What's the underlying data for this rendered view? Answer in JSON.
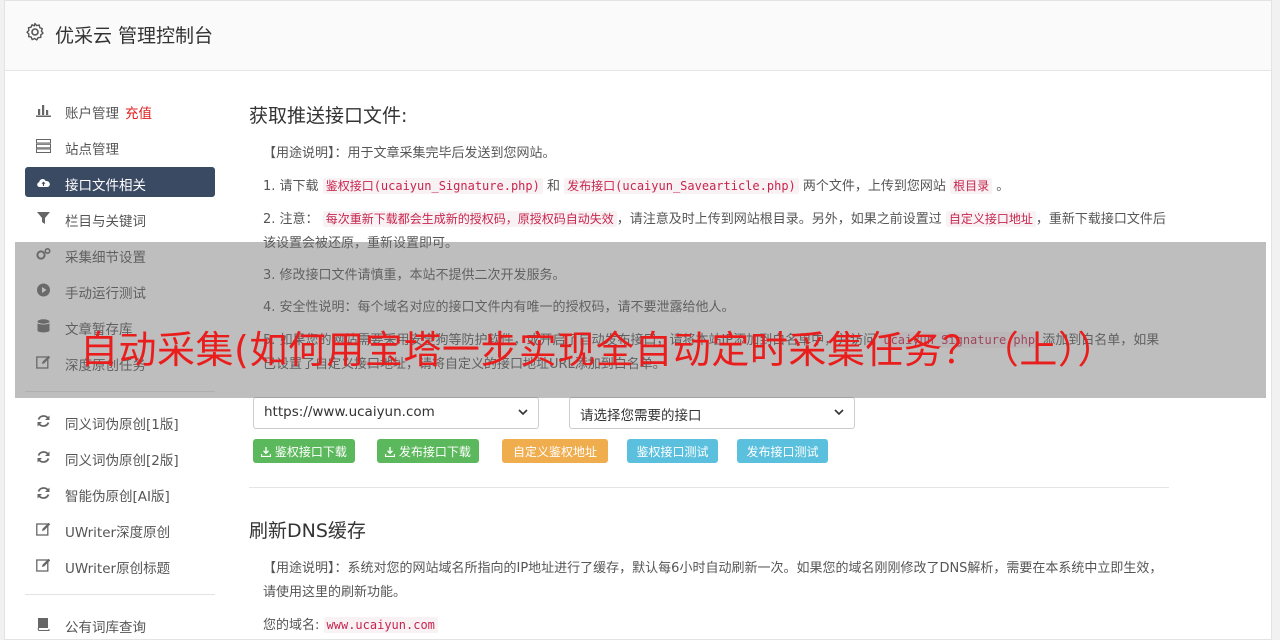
{
  "header": {
    "title": "优采云 管理控制台",
    "icon": "gear-icon"
  },
  "sidebar": {
    "items": [
      {
        "label": "账户管理",
        "badge": "充值",
        "icon": "bar-chart-icon"
      },
      {
        "label": "站点管理",
        "icon": "server-icon"
      },
      {
        "label": "接口文件相关",
        "icon": "cloud-upload-icon",
        "active": true
      },
      {
        "label": "栏目与关键词",
        "icon": "filter-icon"
      },
      {
        "label": "采集细节设置",
        "icon": "gears-icon"
      },
      {
        "label": "手动运行测试",
        "icon": "play-circle-icon"
      },
      {
        "label": "文章暂存库",
        "icon": "database-icon"
      },
      {
        "label": "深度原创任务",
        "icon": "edit-icon"
      }
    ],
    "items2": [
      {
        "label": "同义词伪原创[1版]",
        "icon": "refresh-icon"
      },
      {
        "label": "同义词伪原创[2版]",
        "icon": "refresh-icon"
      },
      {
        "label": "智能伪原创[AI版]",
        "icon": "refresh-icon"
      },
      {
        "label": "UWriter深度原创",
        "icon": "edit-icon"
      },
      {
        "label": "UWriter原创标题",
        "icon": "edit-icon"
      }
    ],
    "items3": [
      {
        "label": "公有词库查询",
        "icon": "book-icon"
      }
    ]
  },
  "section1": {
    "title": "获取推送接口文件:",
    "usage": "【用途说明】：用于文章采集完毕后发送到您网站。",
    "step1_prefix": "1. 请下载",
    "step1_code1": "鉴权接口(ucaiyun_Signature.php)",
    "step1_and": "和",
    "step1_code2": "发布接口(ucaiyun_Savearticle.php)",
    "step1_mid": "两个文件，上传到您网站",
    "step1_code3": "根目录",
    "step1_end": "。",
    "step2_prefix": "2. 注意：",
    "step2_code1": "每次重新下载都会生成新的授权码，原授权码自动失效",
    "step2_mid": "，请注意及时上传到网站根目录。另外，如果之前设置过",
    "step2_code2": "自定义接口地址",
    "step2_end": "，重新下载接口文件后该设置会被还原，重新设置即可。",
    "step3": "3. 修改接口文件请慎重，本站不提供二次开发服务。",
    "step4": "4. 安全性说明：每个域名对应的接口文件内有唯一的授权码，请不要泄露给他人。",
    "step5_prefix": "5. 如果您的网站需要采用安全狗等防护软件，或开启了自动发布接口，请将本站IP添加到白名单中，并访问",
    "step5_code": "ucaiyun_Signature.php",
    "step5_end": "添加到白名单，如果已设置了自定义接口地址，请将自定义的接口地址URL添加到白名单。",
    "site_select": "https://www.ucaiyun.com",
    "iface_select": "请选择您需要的接口",
    "buttons": {
      "auth_download": "鉴权接口下载",
      "publish_download": "发布接口下载",
      "custom_auth": "自定义鉴权地址",
      "auth_test": "鉴权接口测试",
      "publish_test": "发布接口测试"
    },
    "download_icon": "download-icon"
  },
  "section2": {
    "title": "刷新DNS缓存",
    "usage": "【用途说明】：系统对您的网站域名所指向的IP地址进行了缓存，默认每6小时自动刷新一次。如果您的域名刚刚修改了DNS解析，需要在本系统中立即生效，请使用这里的刷新功能。",
    "domain_label": "您的域名:",
    "domain_value": "www.ucaiyun.com"
  },
  "overlay_headline": "自动采集(如何用宝塔一步实现全自动定时采集任务？（上））",
  "colors": {
    "accent_active": "#3a4a63",
    "headline_red": "#ea1d1d",
    "green": "#5cb85c",
    "orange": "#f0ad4e",
    "blue": "#5bc0de"
  }
}
